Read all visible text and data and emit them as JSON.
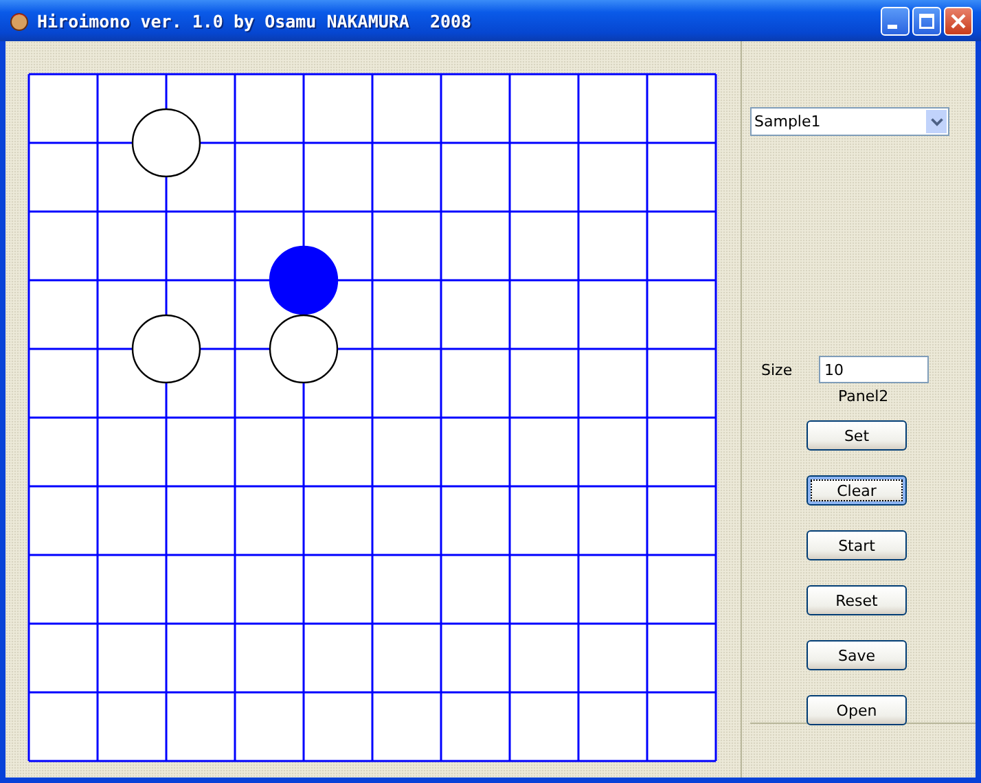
{
  "window": {
    "title": "Hiroimono ver. 1.0 by Osamu NAKAMURA  2008"
  },
  "board": {
    "rows": [
      {
        "points": [
          {
            "stone": false
          },
          {
            "stone": false
          },
          {
            "stone": false
          },
          {
            "stone": false
          },
          {
            "stone": false
          },
          {
            "stone": false
          },
          {
            "stone": false
          },
          {
            "stone": false
          },
          {
            "stone": false
          },
          {
            "stone": false
          },
          {
            "stone": false
          }
        ]
      },
      {
        "points": [
          {
            "stone": false
          },
          {
            "stone": false
          },
          {
            "stone": true,
            "kind": "white"
          },
          {
            "stone": false
          },
          {
            "stone": false
          },
          {
            "stone": false
          },
          {
            "stone": false
          },
          {
            "stone": false
          },
          {
            "stone": false
          },
          {
            "stone": false
          },
          {
            "stone": false
          }
        ]
      },
      {
        "points": [
          {
            "stone": false
          },
          {
            "stone": false
          },
          {
            "stone": false
          },
          {
            "stone": false
          },
          {
            "stone": false
          },
          {
            "stone": false
          },
          {
            "stone": false
          },
          {
            "stone": false
          },
          {
            "stone": false
          },
          {
            "stone": false
          },
          {
            "stone": false
          }
        ]
      },
      {
        "points": [
          {
            "stone": false
          },
          {
            "stone": false
          },
          {
            "stone": false
          },
          {
            "stone": false
          },
          {
            "stone": true,
            "kind": "blue"
          },
          {
            "stone": false
          },
          {
            "stone": false
          },
          {
            "stone": false
          },
          {
            "stone": false
          },
          {
            "stone": false
          },
          {
            "stone": false
          }
        ]
      },
      {
        "points": [
          {
            "stone": false
          },
          {
            "stone": false
          },
          {
            "stone": true,
            "kind": "white"
          },
          {
            "stone": false
          },
          {
            "stone": true,
            "kind": "white"
          },
          {
            "stone": false
          },
          {
            "stone": false
          },
          {
            "stone": false
          },
          {
            "stone": false
          },
          {
            "stone": false
          },
          {
            "stone": false
          }
        ]
      },
      {
        "points": [
          {
            "stone": false
          },
          {
            "stone": false
          },
          {
            "stone": false
          },
          {
            "stone": false
          },
          {
            "stone": false
          },
          {
            "stone": false
          },
          {
            "stone": false
          },
          {
            "stone": false
          },
          {
            "stone": false
          },
          {
            "stone": false
          },
          {
            "stone": false
          }
        ]
      },
      {
        "points": [
          {
            "stone": false
          },
          {
            "stone": false
          },
          {
            "stone": false
          },
          {
            "stone": false
          },
          {
            "stone": false
          },
          {
            "stone": false
          },
          {
            "stone": false
          },
          {
            "stone": false
          },
          {
            "stone": false
          },
          {
            "stone": false
          },
          {
            "stone": false
          }
        ]
      },
      {
        "points": [
          {
            "stone": false
          },
          {
            "stone": false
          },
          {
            "stone": false
          },
          {
            "stone": false
          },
          {
            "stone": false
          },
          {
            "stone": false
          },
          {
            "stone": false
          },
          {
            "stone": false
          },
          {
            "stone": false
          },
          {
            "stone": false
          },
          {
            "stone": false
          }
        ]
      },
      {
        "points": [
          {
            "stone": false
          },
          {
            "stone": false
          },
          {
            "stone": false
          },
          {
            "stone": false
          },
          {
            "stone": false
          },
          {
            "stone": false
          },
          {
            "stone": false
          },
          {
            "stone": false
          },
          {
            "stone": false
          },
          {
            "stone": false
          },
          {
            "stone": false
          }
        ]
      },
      {
        "points": [
          {
            "stone": false
          },
          {
            "stone": false
          },
          {
            "stone": false
          },
          {
            "stone": false
          },
          {
            "stone": false
          },
          {
            "stone": false
          },
          {
            "stone": false
          },
          {
            "stone": false
          },
          {
            "stone": false
          },
          {
            "stone": false
          },
          {
            "stone": false
          }
        ]
      },
      {
        "points": [
          {
            "stone": false
          },
          {
            "stone": false
          },
          {
            "stone": false
          },
          {
            "stone": false
          },
          {
            "stone": false
          },
          {
            "stone": false
          },
          {
            "stone": false
          },
          {
            "stone": false
          },
          {
            "stone": false
          },
          {
            "stone": false
          },
          {
            "stone": false
          }
        ]
      }
    ]
  },
  "sample_select": {
    "value": "Sample1"
  },
  "size": {
    "label": "Size",
    "value": "10"
  },
  "panel_label": "Panel2",
  "buttons": [
    {
      "label": "Set",
      "focused": false
    },
    {
      "label": "Clear",
      "focused": true
    },
    {
      "label": "Start",
      "focused": false
    },
    {
      "label": "Reset",
      "focused": false
    },
    {
      "label": "Save",
      "focused": false
    },
    {
      "label": "Open",
      "focused": false
    }
  ]
}
